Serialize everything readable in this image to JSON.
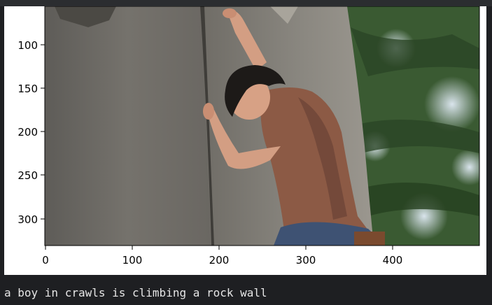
{
  "output_cell": {
    "caption": "a boy in crawls is climbing a rock wall",
    "plot": {
      "x_ticks": [
        "0",
        "100",
        "200",
        "300",
        "400"
      ],
      "y_ticks": [
        "100",
        "150",
        "200",
        "250",
        "300"
      ],
      "image_subject": "person climbing a rock wall"
    }
  },
  "colors": {
    "background": "#1e1f22",
    "figure_background": "#ffffff",
    "caption_text": "#e6e6e6",
    "axis": "#000000"
  }
}
